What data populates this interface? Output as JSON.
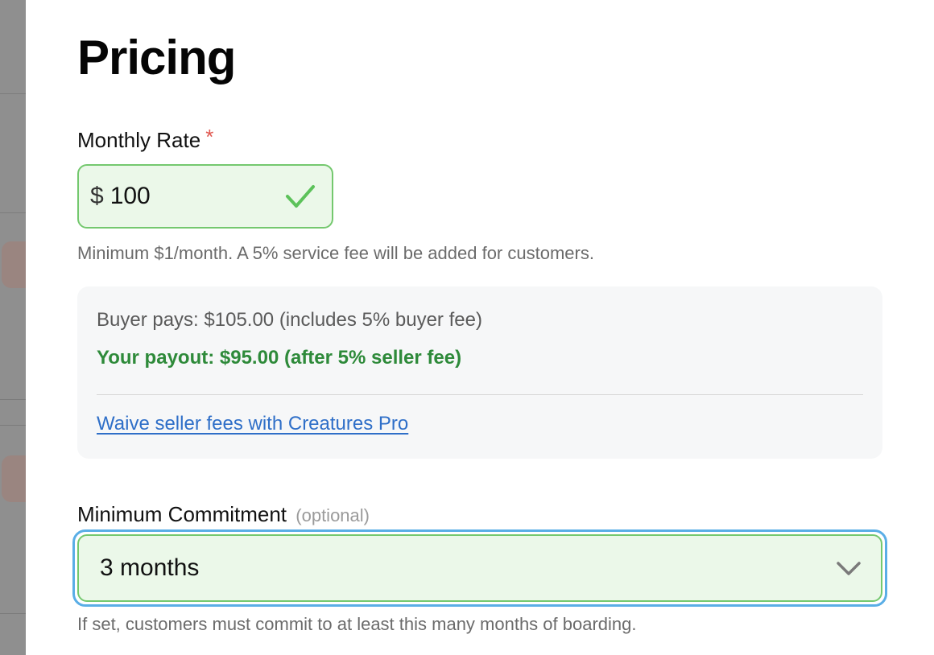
{
  "page": {
    "title": "Pricing"
  },
  "monthly_rate": {
    "label": "Monthly Rate",
    "required_marker": "*",
    "currency_symbol": "$",
    "value": "100",
    "valid": true,
    "help": "Minimum $1/month. A 5% service fee will be added for customers."
  },
  "fee_summary": {
    "buyer_pays": "Buyer pays: $105.00 (includes 5% buyer fee)",
    "payout": "Your payout: $95.00 (after 5% seller fee)",
    "pro_link": "Waive seller fees with Creatures Pro"
  },
  "min_commitment": {
    "label": "Minimum Commitment",
    "optional_tag": "(optional)",
    "selected": "3 months",
    "help": "If set, customers must commit to at least this many months of boarding."
  },
  "colors": {
    "valid_border": "#74c86e",
    "valid_bg": "#ebf8e9",
    "payout_green": "#2e8a3a",
    "link_blue": "#2f6fc8",
    "required_red": "#e0574f",
    "focus_ring": "#5aaee6"
  },
  "icons": {
    "rate_status": "check-icon",
    "select_toggle": "chevron-down-icon"
  }
}
